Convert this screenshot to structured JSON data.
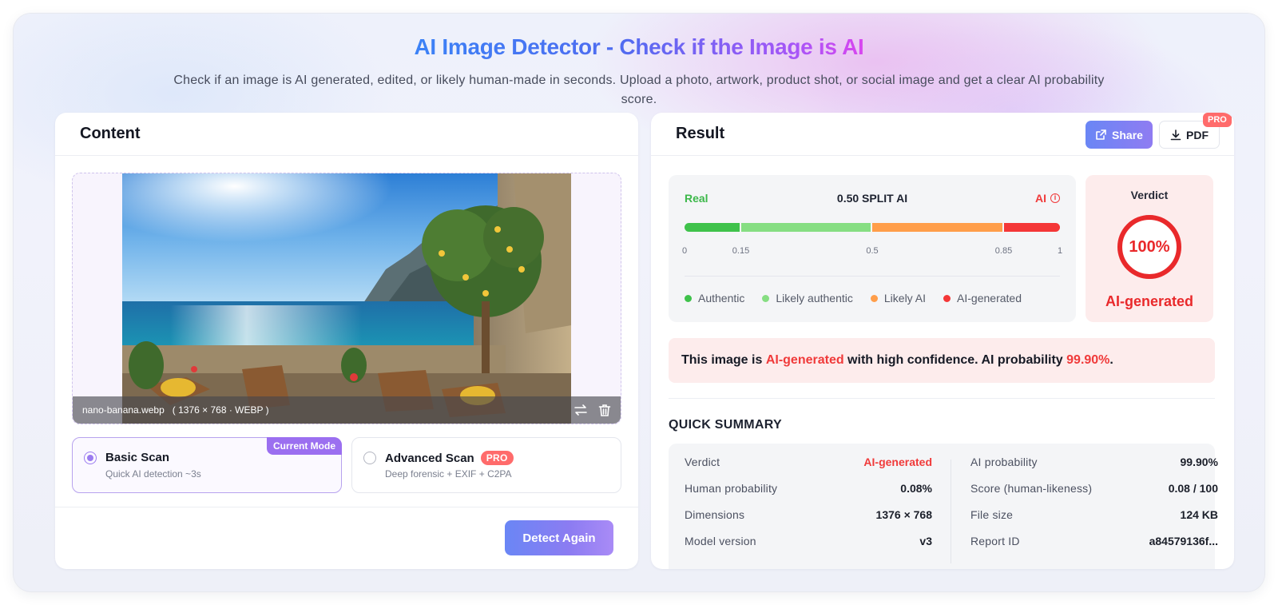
{
  "hero": {
    "title": "AI Image Detector - Check if the Image is AI",
    "subtitle": "Check if an image is AI generated, edited, or likely human-made in seconds. Upload a photo, artwork, product shot, or social image and get a clear AI probability score."
  },
  "content_panel": {
    "title": "Content",
    "image": {
      "filename": "nano-banana.webp",
      "meta": "( 1376 × 768 · WEBP )"
    },
    "modes": [
      {
        "title": "Basic Scan",
        "description": "Quick AI detection ~3s",
        "badge": "Current Mode",
        "selected": true
      },
      {
        "title": "Advanced Scan",
        "description": "Deep forensic + EXIF + C2PA",
        "badge": "PRO",
        "selected": false
      }
    ],
    "detect_button": "Detect Again"
  },
  "result_panel": {
    "title": "Result",
    "share_label": "Share",
    "pdf_label": "PDF",
    "pdf_badge": "PRO",
    "scale": {
      "left_label": "Real",
      "center_label": "0.50 SPLIT AI",
      "right_label": "AI",
      "ticks": [
        "0",
        "0.15",
        "0.5",
        "0.85",
        "1"
      ],
      "segments": [
        {
          "from": 0,
          "to": 0.15,
          "color": "#3fc24b"
        },
        {
          "from": 0.15,
          "to": 0.5,
          "color": "#86de82"
        },
        {
          "from": 0.5,
          "to": 0.85,
          "color": "#ff9e4a"
        },
        {
          "from": 0.85,
          "to": 1,
          "color": "#f43737"
        }
      ],
      "legend": [
        {
          "label": "Authentic",
          "color": "#3fc24b"
        },
        {
          "label": "Likely authentic",
          "color": "#86de82"
        },
        {
          "label": "Likely AI",
          "color": "#ff9e4a"
        },
        {
          "label": "AI-generated",
          "color": "#f43737"
        }
      ]
    },
    "verdict": {
      "label": "Verdict",
      "percent": "100%",
      "percent_value": 1.0,
      "text": "AI-generated",
      "color": "#e9292b"
    },
    "confidence": {
      "prefix": "This image is ",
      "verdict": "AI-generated",
      "middle": " with high confidence. AI probability ",
      "probability": "99.90%",
      "suffix": "."
    },
    "quick_summary": {
      "title": "QUICK SUMMARY",
      "left": [
        {
          "key": "Verdict",
          "value": "AI-generated",
          "highlight": true
        },
        {
          "key": "Human probability",
          "value": "0.08%"
        },
        {
          "key": "Dimensions",
          "value": "1376 × 768"
        },
        {
          "key": "Model version",
          "value": "v3"
        }
      ],
      "right": [
        {
          "key": "AI probability",
          "value": "99.90%"
        },
        {
          "key": "Score (human-likeness)",
          "value": "0.08 / 100"
        },
        {
          "key": "File size",
          "value": "124 KB"
        },
        {
          "key": "Report ID",
          "value": "a84579136f..."
        }
      ]
    }
  }
}
